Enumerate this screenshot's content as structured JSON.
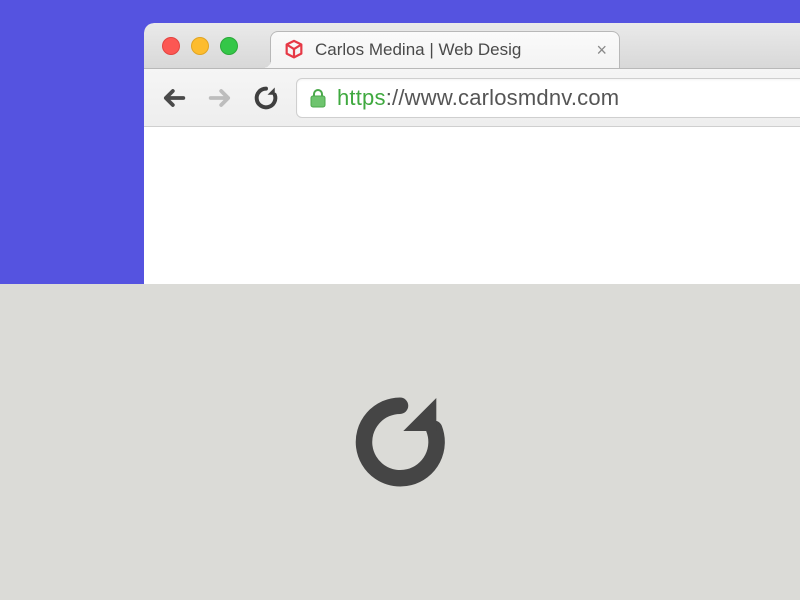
{
  "tab": {
    "title": "Carlos Medina | Web Desig",
    "close": "×"
  },
  "address": {
    "scheme": "https",
    "colon": ":",
    "rest": "//www.carlosmdnv.com"
  },
  "colors": {
    "backdrop": "#5553e0",
    "panel": "#dbdbd7",
    "secure": "#3fa93f"
  }
}
